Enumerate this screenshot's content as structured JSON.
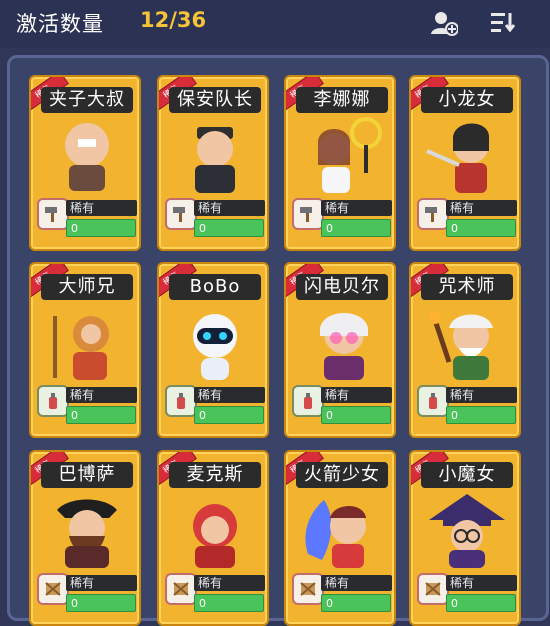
{
  "header": {
    "title": "激活数量",
    "count": "12/36"
  },
  "icons": {
    "add_friend": "add-user-icon",
    "sort": "sort-icon"
  },
  "cards": [
    {
      "name": "夹子大叔",
      "rarity": "稀有",
      "rarity_label": "稀有",
      "progress": "0",
      "skill_icon": "hammer-icon",
      "skill_color": "red"
    },
    {
      "name": "保安队长",
      "rarity": "稀有",
      "rarity_label": "稀有",
      "progress": "0",
      "skill_icon": "hammer-icon",
      "skill_color": "red"
    },
    {
      "name": "李娜娜",
      "rarity": "稀有",
      "rarity_label": "稀有",
      "progress": "0",
      "skill_icon": "hammer-icon",
      "skill_color": "red"
    },
    {
      "name": "小龙女",
      "rarity": "稀有",
      "rarity_label": "稀有",
      "progress": "0",
      "skill_icon": "hammer-icon",
      "skill_color": "red"
    },
    {
      "name": "大师兄",
      "rarity": "稀有",
      "rarity_label": "稀有",
      "progress": "0",
      "skill_icon": "fire-extinguisher-icon",
      "skill_color": "green"
    },
    {
      "name": "BoBo",
      "rarity": "稀有",
      "rarity_label": "稀有",
      "progress": "0",
      "skill_icon": "fire-extinguisher-icon",
      "skill_color": "green"
    },
    {
      "name": "闪电贝尔",
      "rarity": "稀有",
      "rarity_label": "稀有",
      "progress": "0",
      "skill_icon": "fire-extinguisher-icon",
      "skill_color": "green"
    },
    {
      "name": "咒术师",
      "rarity": "稀有",
      "rarity_label": "稀有",
      "progress": "0",
      "skill_icon": "fire-extinguisher-icon",
      "skill_color": "green"
    },
    {
      "name": "巴博萨",
      "rarity": "稀有",
      "rarity_label": "稀有",
      "progress": "0",
      "skill_icon": "crate-icon",
      "skill_color": "red"
    },
    {
      "name": "麦克斯",
      "rarity": "稀有",
      "rarity_label": "稀有",
      "progress": "0",
      "skill_icon": "crate-icon",
      "skill_color": "red"
    },
    {
      "name": "火箭少女",
      "rarity": "稀有",
      "rarity_label": "稀有",
      "progress": "0",
      "skill_icon": "crate-icon",
      "skill_color": "red"
    },
    {
      "name": "小魔女",
      "rarity": "稀有",
      "rarity_label": "稀有",
      "progress": "0",
      "skill_icon": "crate-icon",
      "skill_color": "red"
    }
  ],
  "colors": {
    "background": "#2f3658",
    "card": "#f2b32e",
    "accent": "#f5c23a",
    "progress": "#4bc35b",
    "ribbon": "#d92c3a"
  }
}
